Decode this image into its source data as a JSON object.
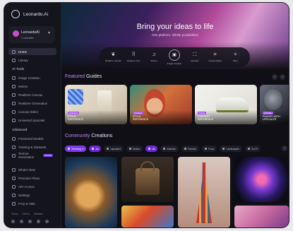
{
  "sidebar": {
    "brand": "Leonardo.Ai",
    "user": {
      "name": "LeonardoAI",
      "sub": "∞ unlimited"
    },
    "nav_top": [
      {
        "label": "Home",
        "icon": "home-icon"
      },
      {
        "label": "Library",
        "icon": "library-icon"
      }
    ],
    "ai_tools_heading": "AI Tools",
    "ai_tools": [
      {
        "label": "Image Creation",
        "icon": "image-icon"
      },
      {
        "label": "Motion",
        "icon": "motion-icon"
      },
      {
        "label": "Realtime Canvas",
        "icon": "canvas-icon"
      },
      {
        "label": "Realtime Generation",
        "icon": "realtime-icon"
      },
      {
        "label": "Canvas Editor",
        "icon": "edit-icon"
      },
      {
        "label": "Universal Upscaler",
        "icon": "upscale-icon"
      }
    ],
    "advanced_heading": "Advanced",
    "advanced": [
      {
        "label": "Finetuned Models",
        "icon": "models-icon"
      },
      {
        "label": "Training & Datasets",
        "icon": "training-icon"
      },
      {
        "label": "Texture Generation",
        "icon": "texture-icon",
        "badge": "ALPHA"
      }
    ],
    "bottom": [
      {
        "label": "What's New",
        "icon": "sparkle-icon"
      },
      {
        "label": "Premium Plans",
        "icon": "premium-icon"
      },
      {
        "label": "API Access",
        "icon": "api-icon"
      },
      {
        "label": "Settings",
        "icon": "gear-icon"
      },
      {
        "label": "FAQ & Help",
        "icon": "help-icon"
      }
    ],
    "footer_links": [
      "Terms",
      "DMCA",
      "Affiliates"
    ]
  },
  "hero": {
    "title": "Bring your ideas to life",
    "subtitle": "One platform, infinite possibilities",
    "tools": [
      {
        "label": "Realtime Canvas",
        "glyph": "❦"
      },
      {
        "label": "Realtime Gen",
        "glyph": "⠿"
      },
      {
        "label": "Motion",
        "glyph": "♫"
      },
      {
        "label": "Image Creation",
        "glyph": "▣",
        "selected": true
      },
      {
        "label": "Upscaler",
        "glyph": "⛶"
      },
      {
        "label": "Canvas Editor",
        "glyph": "⌗"
      },
      {
        "label": "More",
        "glyph": "✧"
      }
    ]
  },
  "guides": {
    "title_accent": "Featured",
    "title_rest": " Guides",
    "items": [
      {
        "badge": "Featured",
        "label_1": "STYLE",
        "label_2": "REFERENCE"
      },
      {
        "badge": "Creative",
        "label_1": "STYLE",
        "label_2": "REFERENCE"
      },
      {
        "badge": "Using",
        "label_1": "CONTENT",
        "label_2": "REFERENCE"
      },
      {
        "badge": "Upscale",
        "label_1": "PHASES WITH",
        "label_2": "UPSCALER"
      }
    ]
  },
  "community": {
    "title_accent": "Community",
    "title_rest": " Creations",
    "filters": [
      {
        "label": "Trending",
        "style": "purple"
      },
      {
        "label": "All",
        "style": "purple2"
      },
      {
        "label": "Upscaled",
        "style": ""
      },
      {
        "label": "Motion",
        "style": ""
      },
      {
        "label": "All",
        "style": "purple2"
      },
      {
        "label": "Animals",
        "style": ""
      },
      {
        "label": "Fashion",
        "style": ""
      },
      {
        "label": "Food",
        "style": ""
      },
      {
        "label": "Landscapes",
        "style": ""
      },
      {
        "label": "Sci-Fi",
        "style": ""
      }
    ]
  }
}
